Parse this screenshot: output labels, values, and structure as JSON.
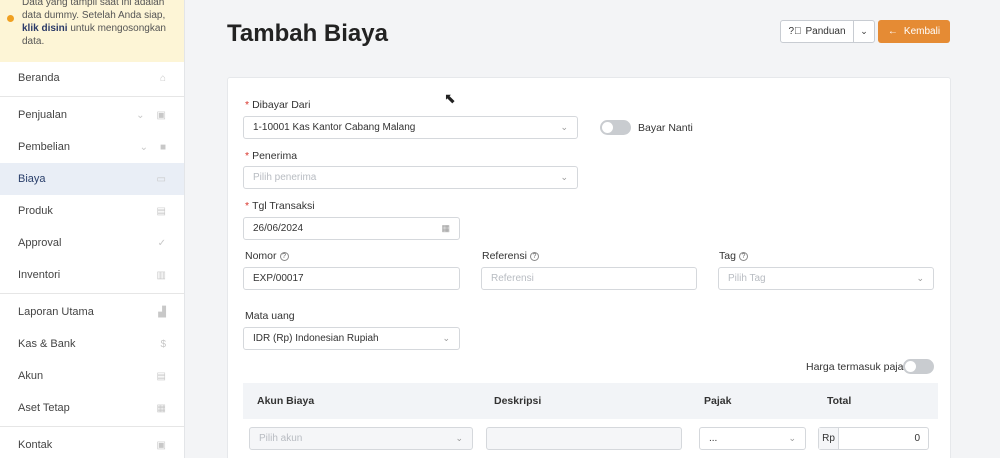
{
  "sidebar": {
    "notice": {
      "line1": "Data yang tampil saat ini adalah data dummy. Setelah Anda siap,",
      "link": "klik disini",
      "line2": "untuk mengosongkan data."
    },
    "items": [
      {
        "label": "Beranda",
        "icon": "home-icon"
      },
      {
        "label": "Penjualan",
        "icon": "basket-icon"
      },
      {
        "label": "Pembelian",
        "icon": "bag-icon"
      },
      {
        "label": "Biaya",
        "icon": "card-icon"
      },
      {
        "label": "Produk",
        "icon": "box-icon"
      },
      {
        "label": "Approval",
        "icon": "check-icon"
      },
      {
        "label": "Inventori",
        "icon": "warehouse-icon"
      },
      {
        "label": "Laporan Utama",
        "icon": "chart-icon"
      },
      {
        "label": "Kas & Bank",
        "icon": "dollar-icon"
      },
      {
        "label": "Akun",
        "icon": "ledger-icon"
      },
      {
        "label": "Aset Tetap",
        "icon": "building-icon"
      },
      {
        "label": "Kontak",
        "icon": "contact-icon"
      }
    ]
  },
  "header": {
    "title": "Tambah Biaya",
    "panduan": "Panduan",
    "kembali": "Kembali"
  },
  "form": {
    "dibayar_dari": {
      "label": "Dibayar Dari",
      "value": "1-10001 Kas Kantor Cabang Malang"
    },
    "bayar_nanti": "Bayar Nanti",
    "penerima": {
      "label": "Penerima",
      "placeholder": "Pilih penerima"
    },
    "tgl": {
      "label": "Tgl Transaksi",
      "value": "26/06/2024"
    },
    "nomor": {
      "label": "Nomor",
      "value": "EXP/00017"
    },
    "referensi": {
      "label": "Referensi",
      "placeholder": "Referensi"
    },
    "tag": {
      "label": "Tag",
      "placeholder": "Pilih Tag"
    },
    "mata_uang": {
      "label": "Mata uang",
      "value": "IDR (Rp) Indonesian Rupiah"
    },
    "harga_pajak": "Harga termasuk pajak"
  },
  "table": {
    "headers": [
      "Akun Biaya",
      "Deskripsi",
      "Pajak",
      "Total"
    ],
    "row": {
      "akun_placeholder": "Pilih akun",
      "pajak": "...",
      "currency": "Rp",
      "total": "0"
    }
  }
}
